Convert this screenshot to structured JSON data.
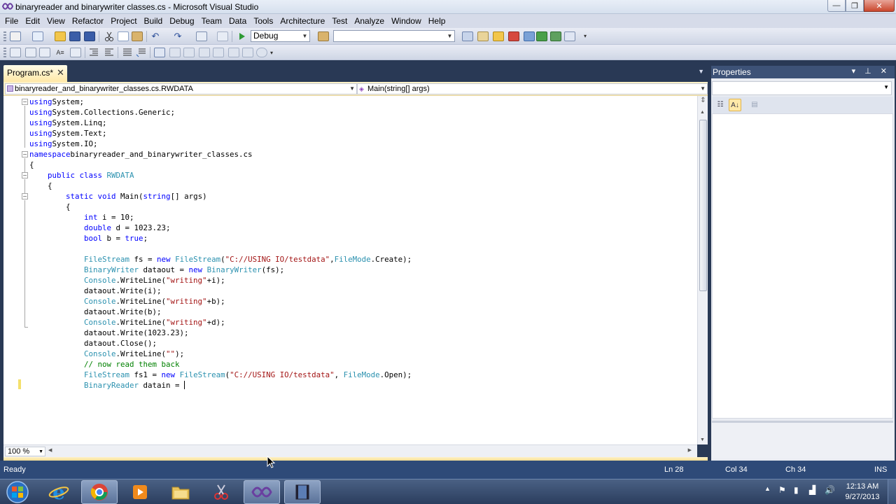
{
  "window": {
    "title": "binaryreader and binarywriter classes.cs - Microsoft Visual Studio",
    "minimize_glyph": "—",
    "maximize_glyph": "❐",
    "close_glyph": "✕"
  },
  "menu": [
    "File",
    "Edit",
    "View",
    "Refactor",
    "Project",
    "Build",
    "Debug",
    "Team",
    "Data",
    "Tools",
    "Architecture",
    "Test",
    "Analyze",
    "Window",
    "Help"
  ],
  "toolbar": {
    "config_value": "Debug",
    "platform_value": "",
    "icons": [
      "new-project-icon",
      "add-item-icon",
      "open-file-icon",
      "save-icon",
      "save-all-icon",
      "cut-icon",
      "copy-icon",
      "paste-icon",
      "undo-icon",
      "redo-icon",
      "navigate-icon",
      "start-debugging-icon",
      "find-in-files-icon",
      "solution-explorer-icon",
      "properties-icon",
      "object-browser-icon",
      "toolbox-icon",
      "start-page-icon"
    ]
  },
  "tab": {
    "label": "Program.cs*",
    "close_glyph": "✕",
    "dropdown_glyph": "▼"
  },
  "navbar": {
    "type_combo": "binaryreader_and_binarywriter_classes.cs.RWDATA",
    "member_combo": "Main(string[] args)"
  },
  "code": [
    [
      [
        "kw",
        "using"
      ],
      [
        "",
        "System;"
      ]
    ],
    [
      [
        "kw",
        "using"
      ],
      [
        "",
        "System.Collections.Generic;"
      ]
    ],
    [
      [
        "kw",
        "using"
      ],
      [
        "",
        "System.Linq;"
      ]
    ],
    [
      [
        "kw",
        "using"
      ],
      [
        "",
        "System.Text;"
      ]
    ],
    [
      [
        "kw",
        "using"
      ],
      [
        "",
        "System.IO;"
      ]
    ],
    [
      [
        "kw",
        "namespace"
      ],
      [
        "",
        "binaryreader_and_binarywriter_classes.cs"
      ]
    ],
    [
      [
        "",
        "{"
      ]
    ],
    [
      [
        "",
        "    "
      ],
      [
        "kw",
        "public class"
      ],
      [
        "",
        " "
      ],
      [
        "ty",
        "RWDATA"
      ]
    ],
    [
      [
        "",
        "    {"
      ]
    ],
    [
      [
        "",
        "        "
      ],
      [
        "kw",
        "static void"
      ],
      [
        "",
        " Main("
      ],
      [
        "kw",
        "string"
      ],
      [
        "",
        "[] args)"
      ]
    ],
    [
      [
        "",
        "        {"
      ]
    ],
    [
      [
        "",
        "            "
      ],
      [
        "kw",
        "int"
      ],
      [
        "",
        " i = 10;"
      ]
    ],
    [
      [
        "",
        "            "
      ],
      [
        "kw",
        "double"
      ],
      [
        "",
        " d = 1023.23;"
      ]
    ],
    [
      [
        "",
        "            "
      ],
      [
        "kw",
        "bool"
      ],
      [
        "",
        " b = "
      ],
      [
        "kw",
        "true"
      ],
      [
        "",
        ";"
      ]
    ],
    [],
    [
      [
        "",
        "            "
      ],
      [
        "ty",
        "FileStream"
      ],
      [
        "",
        " fs = "
      ],
      [
        "kw",
        "new"
      ],
      [
        "",
        " "
      ],
      [
        "ty",
        "FileStream"
      ],
      [
        "",
        "("
      ],
      [
        "st",
        "\"C://USING IO/testdata\""
      ],
      [
        "",
        ","
      ],
      [
        "ty",
        "FileMode"
      ],
      [
        "",
        ".Create);"
      ]
    ],
    [
      [
        "",
        "            "
      ],
      [
        "ty",
        "BinaryWriter"
      ],
      [
        "",
        " dataout = "
      ],
      [
        "kw",
        "new"
      ],
      [
        "",
        " "
      ],
      [
        "ty",
        "BinaryWriter"
      ],
      [
        "",
        "(fs);"
      ]
    ],
    [
      [
        "",
        "            "
      ],
      [
        "ty",
        "Console"
      ],
      [
        "",
        ".WriteLine("
      ],
      [
        "st",
        "\"writing\""
      ],
      [
        "",
        "+i);"
      ]
    ],
    [
      [
        "",
        "            dataout.Write(i);"
      ]
    ],
    [
      [
        "",
        "            "
      ],
      [
        "ty",
        "Console"
      ],
      [
        "",
        ".WriteLine("
      ],
      [
        "st",
        "\"writing\""
      ],
      [
        "",
        "+b);"
      ]
    ],
    [
      [
        "",
        "            dataout.Write(b);"
      ]
    ],
    [
      [
        "",
        "            "
      ],
      [
        "ty",
        "Console"
      ],
      [
        "",
        ".WriteLine("
      ],
      [
        "st",
        "\"writing\""
      ],
      [
        "",
        "+d);"
      ]
    ],
    [
      [
        "",
        "            dataout.Write(1023.23);"
      ]
    ],
    [
      [
        "",
        "            dataout.Close();"
      ]
    ],
    [
      [
        "",
        "            "
      ],
      [
        "ty",
        "Console"
      ],
      [
        "",
        ".WriteLine("
      ],
      [
        "st",
        "\"\""
      ],
      [
        "",
        ");"
      ]
    ],
    [
      [
        "",
        "            "
      ],
      [
        "cm",
        "// now read them back"
      ]
    ],
    [
      [
        "",
        "            "
      ],
      [
        "ty",
        "FileStream"
      ],
      [
        "",
        " fs1 = "
      ],
      [
        "kw",
        "new"
      ],
      [
        "",
        " "
      ],
      [
        "ty",
        "FileStream"
      ],
      [
        "",
        "("
      ],
      [
        "st",
        "\"C://USING IO/testdata\""
      ],
      [
        "",
        ", "
      ],
      [
        "ty",
        "FileMode"
      ],
      [
        "",
        ".Open);"
      ]
    ],
    [
      [
        "",
        "            "
      ],
      [
        "ty",
        "BinaryReader"
      ],
      [
        "",
        " datain ="
      ]
    ]
  ],
  "editor": {
    "zoom": "100 %"
  },
  "properties": {
    "title": "Properties",
    "header_controls": "▾ ⊥ ✕"
  },
  "status": {
    "ready": "Ready",
    "ln": "Ln 28",
    "col": "Col 34",
    "ch": "Ch 34",
    "ins": "INS"
  },
  "taskbar": {
    "time": "12:13 AM",
    "date": "9/27/2013",
    "apps": [
      "internet-explorer-icon",
      "chrome-icon",
      "media-player-icon",
      "file-explorer-icon",
      "snipping-tool-icon",
      "visual-studio-icon",
      "video-icon"
    ]
  },
  "colors": {
    "accent": "#293955",
    "keyword": "#0000ff",
    "type": "#2b91af",
    "string": "#a31515",
    "comment": "#008000"
  }
}
